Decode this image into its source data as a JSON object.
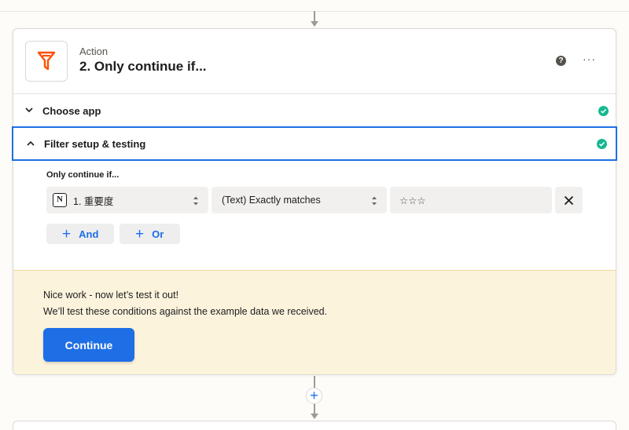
{
  "step": {
    "kind": "Action",
    "title": "2. Only continue if...",
    "status": "complete",
    "app_icon": "filter-icon",
    "help_icon": "?",
    "more_icon": "···"
  },
  "sections": [
    {
      "label": "Choose app",
      "expanded": false,
      "complete": true
    },
    {
      "label": "Filter setup & testing",
      "expanded": true,
      "complete": true
    }
  ],
  "filter": {
    "title": "Only continue if...",
    "rule": {
      "field": "1. 重要度",
      "field_icon": "notion-icon",
      "field_icon_glyph": "N",
      "operator": "(Text) Exactly matches",
      "value": "☆☆☆"
    },
    "add_and_label": "And",
    "add_or_label": "Or",
    "add_glyph": "+"
  },
  "notice": {
    "line1": "Nice work - now let’s test it out!",
    "line2": "We’ll test these conditions against the example data we received.",
    "continue_label": "Continue"
  },
  "add_step_glyph": "+",
  "colors": {
    "accent": "#1e6ee6",
    "success": "#17b890",
    "notice_bg": "#fcf3dc",
    "brand_filter": "#ff4f00"
  }
}
